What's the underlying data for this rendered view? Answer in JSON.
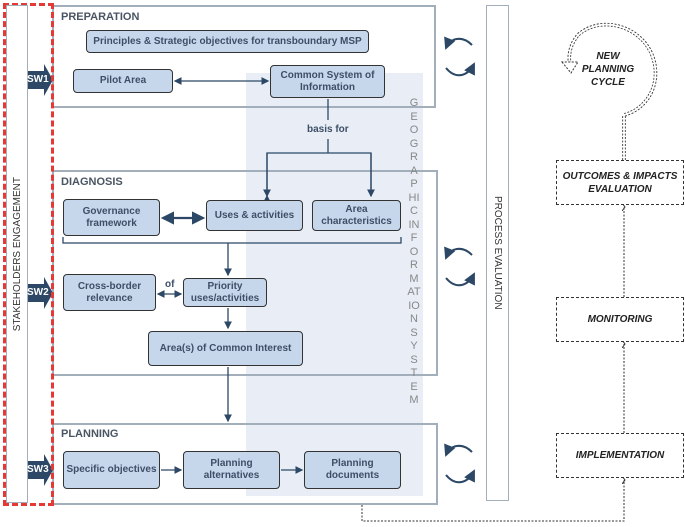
{
  "stakeholders": {
    "label": "STAKEHOLDERS ENGAGEMENT",
    "steps": [
      "SW1",
      "SW2",
      "SW3"
    ]
  },
  "phases": {
    "preparation": "PREPARATION",
    "diagnosis": "DIAGNOSIS",
    "planning": "PLANNING"
  },
  "nodes": {
    "principles": "Principles & Strategic objectives for transboundary MSP",
    "pilot_area": "Pilot Area",
    "csi": "Common System of Information",
    "governance": "Governance framework",
    "uses": "Uses & activities",
    "area_char": "Area characteristics",
    "cross_border": "Cross-border relevance",
    "priority": "Priority uses/activities",
    "aci": "Area(s) of Common Interest",
    "specific": "Specific objectives",
    "alternatives": "Planning alternatives",
    "documents": "Planning documents"
  },
  "labels": {
    "basis_for": "basis for",
    "of": "of"
  },
  "gis": "GEOGRAPHIC INFORMATION SYSTEM",
  "process_evaluation": "PROCESS EVALUATION",
  "cycle": {
    "new_cycle": "NEW PLANNING CYCLE",
    "outcomes": "OUTCOMES & IMPACTS EVALUATION",
    "monitoring": "MONITORING",
    "implementation": "IMPLEMENTATION"
  },
  "colors": {
    "node_fill": "#c6d7ec",
    "gis_band": "#e8edf6",
    "stakeholder_dash": "#e53935",
    "arrow": "#2c4866"
  }
}
